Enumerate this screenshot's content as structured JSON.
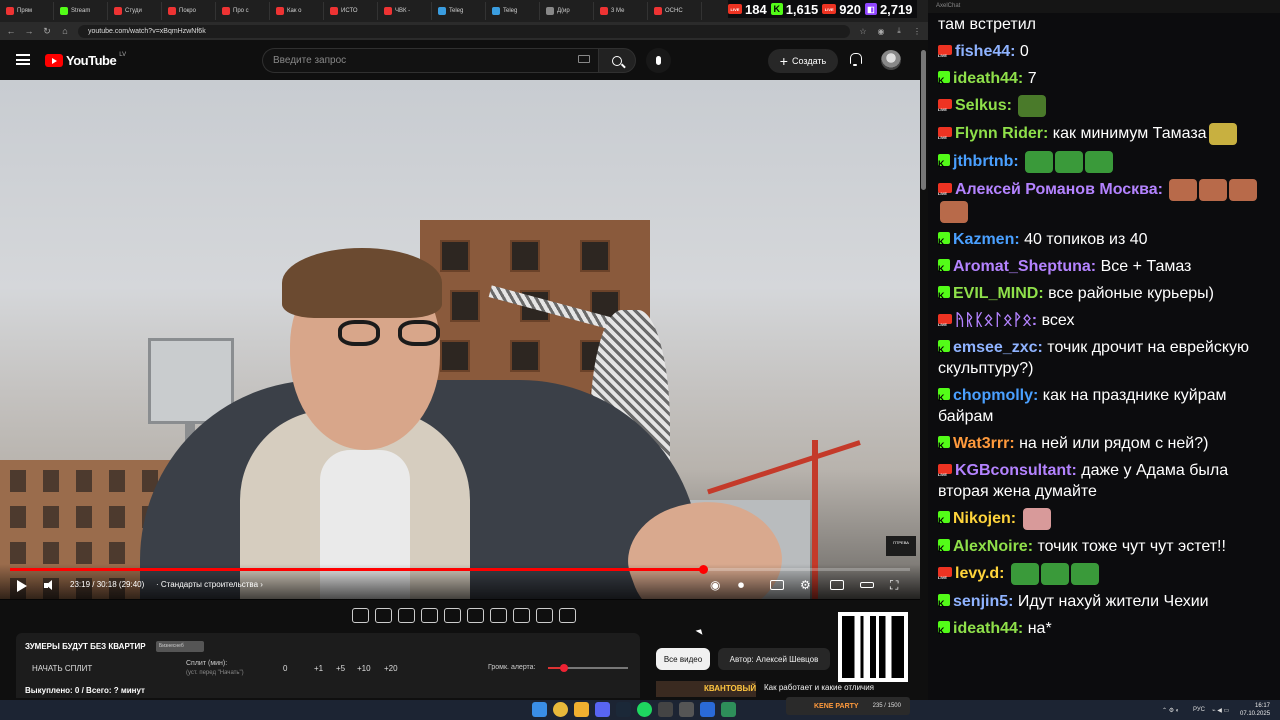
{
  "browser": {
    "tabs": [
      {
        "label": "Прям",
        "color": "#e33"
      },
      {
        "label": "Stream",
        "color": "#53fc18"
      },
      {
        "label": "Студи",
        "color": "#e33"
      },
      {
        "label": "Покро",
        "color": "#e33"
      },
      {
        "label": "Про с",
        "color": "#e33"
      },
      {
        "label": "Как о",
        "color": "#e33"
      },
      {
        "label": "ИСТО",
        "color": "#e33"
      },
      {
        "label": "ЧВК -",
        "color": "#e33"
      },
      {
        "label": "Teleg",
        "color": "#3a9de0"
      },
      {
        "label": "Teleg",
        "color": "#3a9de0"
      },
      {
        "label": "Д(ир",
        "color": "#888"
      },
      {
        "label": "3 Ме",
        "color": "#e33"
      },
      {
        "label": "ОСНС",
        "color": "#e33"
      }
    ],
    "url": "youtube.com/watch?v=xBqmHzwNf6k"
  },
  "youtube": {
    "logo_text": "YouTube",
    "country": "LV",
    "search_placeholder": "Введите запрос",
    "create_label": "Создать",
    "create_plus": "+"
  },
  "player": {
    "time": "23:19 / 30:18 (29:40)",
    "chapter": "· Стандарты строительства ›",
    "progress": 0.77,
    "watermark": "ПТРЕВА"
  },
  "panel": {
    "title": "ЗУМЕРЫ БУДУТ БЕЗ КВАРТИР",
    "tag": "Бизнеснеб",
    "start_label": "НАЧАТЬ СПЛИТ",
    "split_label": "Сплит (мин):",
    "split_hint": "(уст. перед \"Начать\")",
    "split_values": [
      "0",
      "+1",
      "+5",
      "+10",
      "+20"
    ],
    "alert_label": "Громк. алерта:",
    "alert_volume": 0.2,
    "stats": "Выкуплено: 0 / Всего: ? минут"
  },
  "recommendations": {
    "chip_all": "Все видео",
    "chip_author": "Автор: Алексей Шевцов",
    "rec_badge": "КВАНТОВЫЙ",
    "rec_title": "Как работает и какие отличия"
  },
  "chat": {
    "app_title": "AxelChat",
    "viewers": [
      {
        "platform": "youtube",
        "count": "184"
      },
      {
        "platform": "kick",
        "count": "1,615"
      },
      {
        "platform": "vk",
        "count": "920"
      },
      {
        "platform": "twitch",
        "count": "2,719"
      }
    ],
    "messages": [
      {
        "platform": "",
        "name": "",
        "color": "#ffffff",
        "text": "там встретил",
        "emotes": []
      },
      {
        "platform": "youtube",
        "name": "fishe44:",
        "color": "#8fb3ff",
        "text": "0",
        "emotes": []
      },
      {
        "platform": "kick",
        "name": "ideath44:",
        "color": "#8fe04a",
        "text": "7",
        "emotes": []
      },
      {
        "platform": "youtube",
        "name": "Selkus:",
        "color": "#8fe04a",
        "text": "",
        "emotes": [
          "#4a7a2a"
        ]
      },
      {
        "platform": "youtube",
        "name": "Flynn Rider:",
        "color": "#8fe04a",
        "text": "как минимум Тамаза",
        "emotes": [
          "#c8b040"
        ]
      },
      {
        "platform": "kick",
        "name": "jthbrtnb:",
        "color": "#4aa0ff",
        "text": "",
        "emotes": [
          "#3a9a3a",
          "#3a9a3a",
          "#3a9a3a"
        ]
      },
      {
        "platform": "youtube",
        "name": "Алексей Романов Москва:",
        "color": "#b483ff",
        "text": "",
        "emotes": [
          "#b86a4a",
          "#b86a4a",
          "#b86a4a",
          "#b86a4a"
        ]
      },
      {
        "platform": "kick",
        "name": "Kazmen:",
        "color": "#4aa0ff",
        "text": "40 топиков из 40",
        "emotes": []
      },
      {
        "platform": "kick",
        "name": "Aromat_Sheptuna:",
        "color": "#b483ff",
        "text": "Все + Тамаз",
        "emotes": []
      },
      {
        "platform": "kick",
        "name": "EVIL_MIND:",
        "color": "#8fe04a",
        "text": "все районые курьеры)",
        "emotes": []
      },
      {
        "platform": "youtube",
        "name": "ᚤᚱᛕᛟᛚᛟᚹᛟ:",
        "color": "#b483ff",
        "text": "всех",
        "emotes": []
      },
      {
        "platform": "kick",
        "name": "emsee_zxc:",
        "color": "#8fb3ff",
        "text": "точик дрочит на еврейскую скульптуру?)",
        "emotes": []
      },
      {
        "platform": "kick",
        "name": "chopmolly:",
        "color": "#4aa0ff",
        "text": "как на празднике куйрам байрам",
        "emotes": []
      },
      {
        "platform": "kick",
        "name": "Wat3rrr:",
        "color": "#ff9a3c",
        "text": "на ней или рядом с ней?)",
        "emotes": []
      },
      {
        "platform": "youtube",
        "name": "KGBconsultant:",
        "color": "#b483ff",
        "text": "даже у Адама была вторая жена думайте",
        "emotes": []
      },
      {
        "platform": "kick",
        "name": "Nikojen:",
        "color": "#ffd43b",
        "text": "",
        "emotes": [
          "#d89a9a"
        ]
      },
      {
        "platform": "kick",
        "name": "AlexNoire:",
        "color": "#8fe04a",
        "text": "точик тоже чут чут эстет!!",
        "emotes": []
      },
      {
        "platform": "youtube",
        "name": "levy.d:",
        "color": "#ffd43b",
        "text": "",
        "emotes": [
          "#3a9a3a",
          "#3a9a3a",
          "#3a9a3a"
        ]
      },
      {
        "platform": "kick",
        "name": "senjin5:",
        "color": "#8fb3ff",
        "text": "Идут нахуй жители Чехии",
        "emotes": []
      },
      {
        "platform": "kick",
        "name": "ideath44:",
        "color": "#8fe04a",
        "text": "на*",
        "emotes": []
      }
    ]
  },
  "taskbar": {
    "kick_widget": "KENE PARTY",
    "kick_widget_value": "235 / 1500",
    "lang": "РУС",
    "time": "16:17",
    "date": "07.10.2025"
  }
}
